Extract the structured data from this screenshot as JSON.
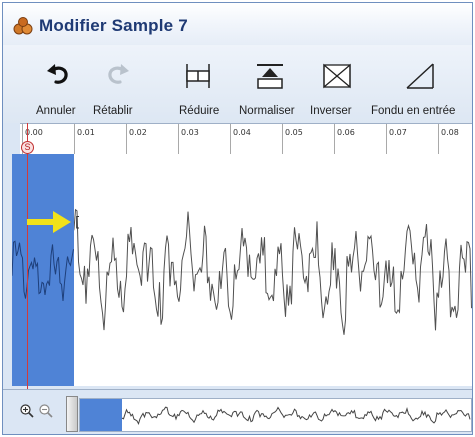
{
  "window": {
    "title": "Modifier Sample 7"
  },
  "toolbar": {
    "buttons": [
      {
        "label": "Annuler",
        "icon": "undo-icon",
        "enabled": true
      },
      {
        "label": "Rétablir",
        "icon": "redo-icon",
        "enabled": false
      },
      {
        "label": "Réduire",
        "icon": "reduce-icon",
        "enabled": true
      },
      {
        "label": "Normaliser",
        "icon": "normalize-icon",
        "enabled": true
      },
      {
        "label": "Inverser",
        "icon": "invert-icon",
        "enabled": true
      },
      {
        "label": "Fondu en entrée",
        "icon": "fade-in-icon",
        "enabled": true
      }
    ]
  },
  "ruler": {
    "ticks": [
      "0.00",
      "0.01",
      "0.02",
      "0.03",
      "0.04",
      "0.05",
      "0.06",
      "0.07",
      "0.08"
    ]
  },
  "marker": {
    "label": "S"
  },
  "colors": {
    "selection": "#4f83d6",
    "cursor": "#d43a3a",
    "arrow": "#f2e21a",
    "wave": "#505050"
  },
  "navigator": {
    "zoom_in": "zoom-in-icon",
    "zoom_out": "zoom-out-icon"
  }
}
